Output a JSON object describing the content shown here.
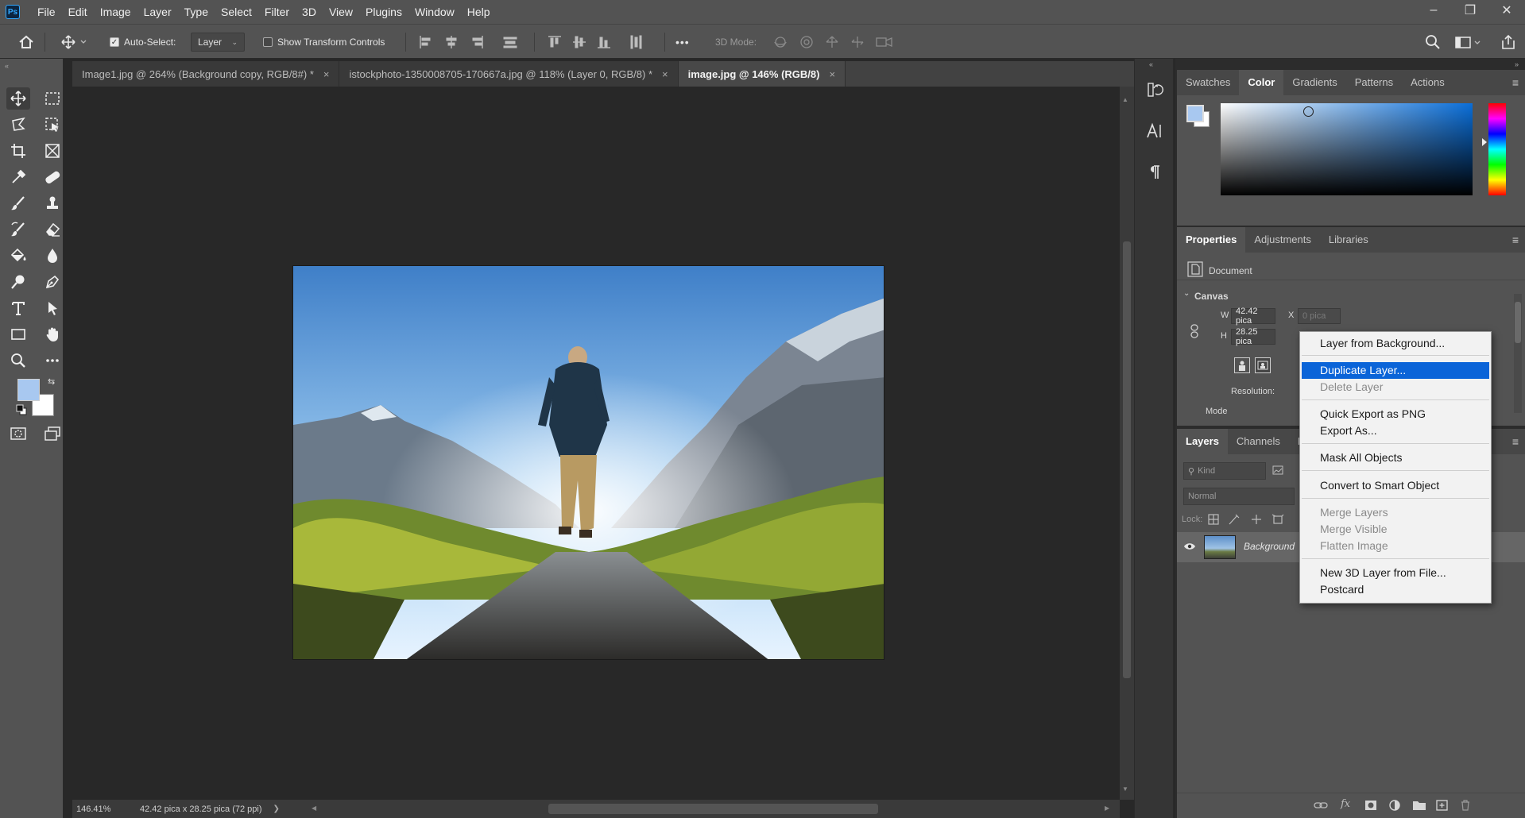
{
  "app": {
    "logo": "Ps",
    "menu": [
      "File",
      "Edit",
      "Image",
      "Layer",
      "Type",
      "Select",
      "Filter",
      "3D",
      "View",
      "Plugins",
      "Window",
      "Help"
    ],
    "window_controls": {
      "minimize": "–",
      "restore": "❐",
      "close": "✕"
    }
  },
  "options_bar": {
    "auto_select_label": "Auto-Select:",
    "auto_select_checked": true,
    "auto_select_target": "Layer",
    "show_transform_label": "Show Transform Controls",
    "more_label": "•••",
    "mode_3d_label": "3D Mode:"
  },
  "colors": {
    "foreground": "#a8c8f0",
    "background": "#ffffff",
    "accent_highlight": "#0a64d8"
  },
  "tabs": [
    {
      "label": "Image1.jpg @ 264% (Background copy, RGB/8#) *",
      "active": false
    },
    {
      "label": "istockphoto-1350008705-170667a.jpg @ 118% (Layer 0, RGB/8) *",
      "active": false
    },
    {
      "label": "image.jpg @ 146% (RGB/8)",
      "active": true
    }
  ],
  "tab_close_glyph": "×",
  "status": {
    "zoom": "146.41%",
    "doc_size": "42.42 pica x 28.25 pica (72 ppi)",
    "arrow": "❯"
  },
  "color_panel": {
    "tabs": [
      "Swatches",
      "Color",
      "Gradients",
      "Patterns",
      "Actions"
    ],
    "active_tab": "Color"
  },
  "properties_panel": {
    "tabs": [
      "Properties",
      "Adjustments",
      "Libraries"
    ],
    "doc_label": "Document",
    "section": "Canvas",
    "w_label": "W",
    "w_value": "42.42 pica",
    "h_label": "H",
    "h_value": "28.25 pica",
    "x_label": "X",
    "x_value": "0 pica",
    "resolution_label": "Resolution:",
    "mode_label": "Mode"
  },
  "layers_panel": {
    "tabs": [
      "Layers",
      "Channels",
      "Pa"
    ],
    "kind_placeholder": "Kind",
    "blend_mode": "Normal",
    "lock_label": "Lock:",
    "layer_name": "Background",
    "footer_icons": [
      "link-icon",
      "fx-icon",
      "mask-icon",
      "adjustment-icon",
      "folder-icon",
      "new-layer-icon",
      "trash-icon"
    ],
    "fx_label": "fx"
  },
  "context_menu": {
    "items": [
      {
        "label": "Layer from Background...",
        "state": "normal"
      },
      {
        "label": "Duplicate Layer...",
        "state": "highlighted"
      },
      {
        "label": "Delete Layer",
        "state": "disabled"
      },
      {
        "label": "Quick Export as PNG",
        "state": "normal"
      },
      {
        "label": "Export As...",
        "state": "normal"
      },
      {
        "label": "Mask All Objects",
        "state": "normal"
      },
      {
        "label": "Convert to Smart Object",
        "state": "normal"
      },
      {
        "label": "Merge Layers",
        "state": "disabled"
      },
      {
        "label": "Merge Visible",
        "state": "disabled"
      },
      {
        "label": "Flatten Image",
        "state": "disabled"
      },
      {
        "label": "New 3D Layer from File...",
        "state": "normal"
      },
      {
        "label": "Postcard",
        "state": "normal"
      }
    ]
  }
}
